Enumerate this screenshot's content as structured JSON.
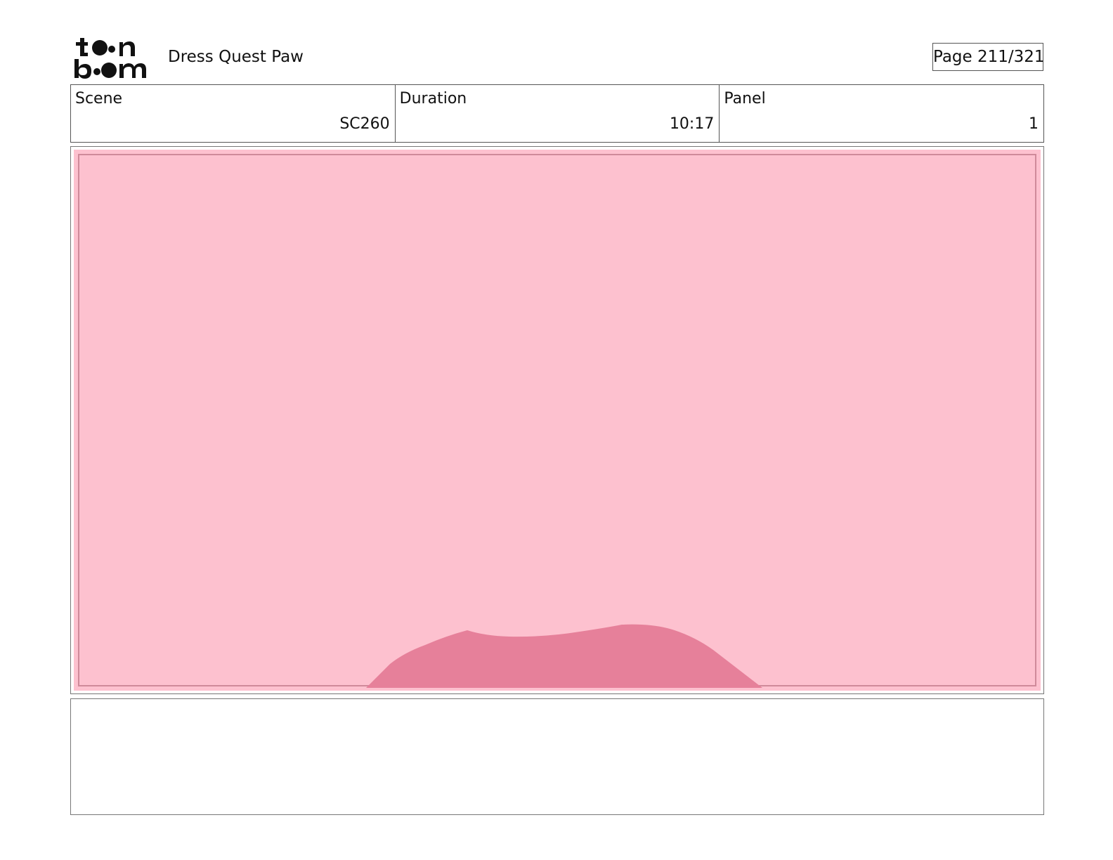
{
  "header": {
    "project_title": "Dress Quest Paw",
    "page_indicator": "Page 211/321"
  },
  "info": {
    "scene_label": "Scene",
    "scene_value": "SC260",
    "duration_label": "Duration",
    "duration_value": "10:17",
    "panel_label": "Panel",
    "panel_value": "1"
  },
  "colors": {
    "panel_background": "#fdc1cf",
    "shape_fill": "#e6809a",
    "frame_line": "#d98b9c"
  }
}
